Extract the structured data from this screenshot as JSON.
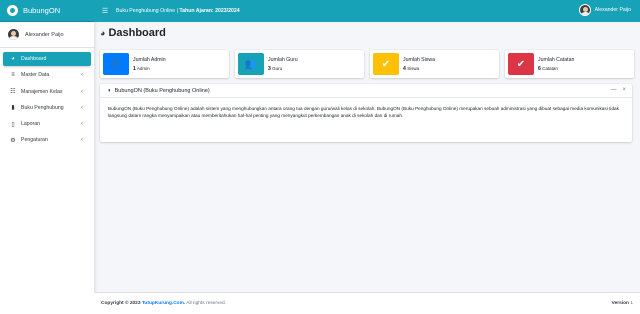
{
  "brand": {
    "name": "BubungON"
  },
  "user": {
    "name": "Alexander Paijo"
  },
  "sidebar": {
    "items": [
      {
        "label": "Dashboard",
        "icon": "dashboard-icon",
        "glyph": "◕",
        "active": true,
        "caret": ""
      },
      {
        "label": "Master Data",
        "icon": "database-icon",
        "glyph": "≡",
        "active": false,
        "caret": "‹"
      },
      {
        "label": "Manajemen Kelas",
        "icon": "users-icon",
        "glyph": "☷",
        "active": false,
        "caret": "‹"
      },
      {
        "label": "Buku Penghubung",
        "icon": "book-icon",
        "glyph": "▮",
        "active": false,
        "caret": "‹"
      },
      {
        "label": "Laporan",
        "icon": "file-icon",
        "glyph": "▯",
        "active": false,
        "caret": "‹"
      },
      {
        "label": "Pengaturan",
        "icon": "gear-icon",
        "glyph": "⚙",
        "active": false,
        "caret": "‹"
      }
    ]
  },
  "topbar": {
    "title": "Buku Penghubung Online | ",
    "title_bold": "Tahun Ajaran: 2023/2024"
  },
  "page": {
    "title": "Dashboard"
  },
  "info_boxes": [
    {
      "label": "Jumlah Admin",
      "count": "1",
      "unit": "Admin",
      "color": "#007bff",
      "icon": "user-secret-icon",
      "glyph": "👤"
    },
    {
      "label": "Jumlah Guru",
      "count": "3",
      "unit": "Guru",
      "color": "#17a2b8",
      "icon": "users-icon",
      "glyph": "👥"
    },
    {
      "label": "Jumlah Siswa",
      "count": "4",
      "unit": "Siswa",
      "color": "#ffc107",
      "icon": "check-icon",
      "glyph": "✔"
    },
    {
      "label": "Jumlah Catatan",
      "count": "6",
      "unit": "Catatan",
      "color": "#dc3545",
      "icon": "check-icon",
      "glyph": "✔"
    }
  ],
  "card": {
    "title": "BubungON (Buku Penghubung Online)",
    "body": "BubungON (Buku Penghubung Online) adalah sistem yang menghubungkan antara orang tua dengan guru/wali kelas di sekolah. BubungON (Buku Penghubung Online) merupakan sebuah administrasi yang dibuat sebagai media komunikasi tidak langsung dalam rangka menyampaikan atau memberitahukan hal-hal penting yang menyangkut perkembangan anak di sekolah dan di rumah.",
    "minimize": "—",
    "close": "×"
  },
  "footer": {
    "copyright": "Copyright © 2023 ",
    "link": "TutupKurung.Com.",
    "rights": " All rights reserved.",
    "version_label": "Version",
    "version": "1"
  }
}
